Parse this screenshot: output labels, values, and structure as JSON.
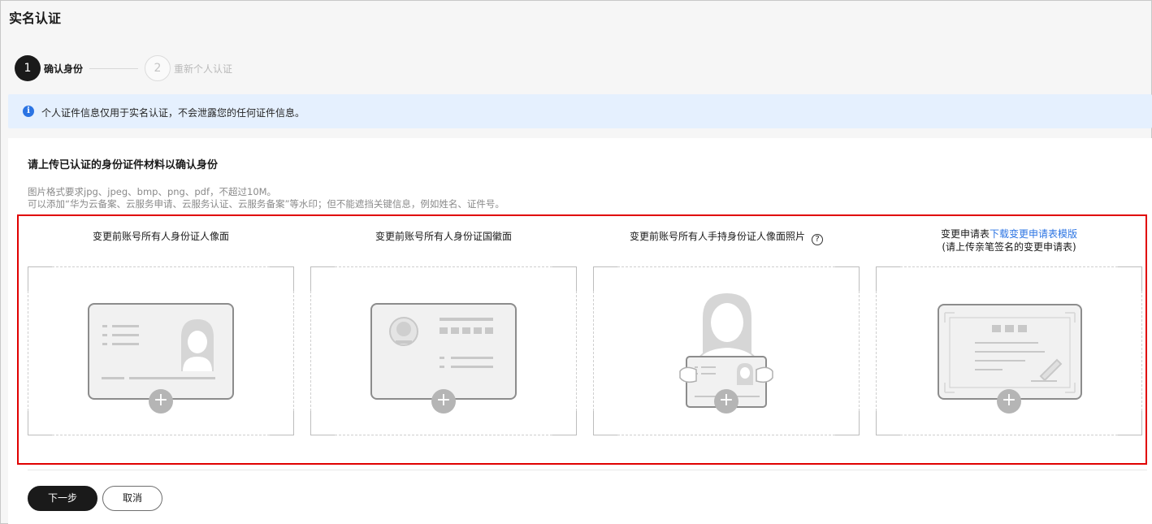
{
  "page": {
    "title": "实名认证"
  },
  "stepper": {
    "steps": [
      {
        "number": "1",
        "label": "确认身份",
        "state": "active"
      },
      {
        "number": "2",
        "label": "重新个人认证",
        "state": "pending"
      }
    ]
  },
  "banner": {
    "icon": "info-icon",
    "icon_glyph": "i",
    "text": "个人证件信息仅用于实名认证，不会泄露您的任何证件信息。",
    "color": "#2b74e3"
  },
  "upload_section": {
    "title": "请上传已认证的身份证件材料以确认身份",
    "requirements": [
      "图片格式要求jpg、jpeg、bmp、png、pdf，不超过10M。",
      "可以添加“华为云备案、云服务申请、云服务认证、云服务备案”等水印；但不能遮挡关键信息，例如姓名、证件号。"
    ],
    "slots": [
      {
        "label": "变更前账号所有人身份证人像面",
        "icon": "id-card-portrait-icon"
      },
      {
        "label": "变更前账号所有人身份证国徽面",
        "icon": "id-card-emblem-icon"
      },
      {
        "label": "变更前账号所有人手持身份证人像面照片",
        "help": "?",
        "icon": "person-holding-id-icon"
      },
      {
        "label": "变更申请表",
        "link": "下载变更申请表模版",
        "note": "(请上传亲笔签名的变更申请表)",
        "icon": "application-form-icon"
      }
    ],
    "plus_glyph": "+"
  },
  "actions": {
    "next_label": "下一步",
    "cancel_label": "取消"
  },
  "colors": {
    "accent": "#2b74e3",
    "highlight_border": "#e00000",
    "primary_button": "#1a1a1a"
  }
}
